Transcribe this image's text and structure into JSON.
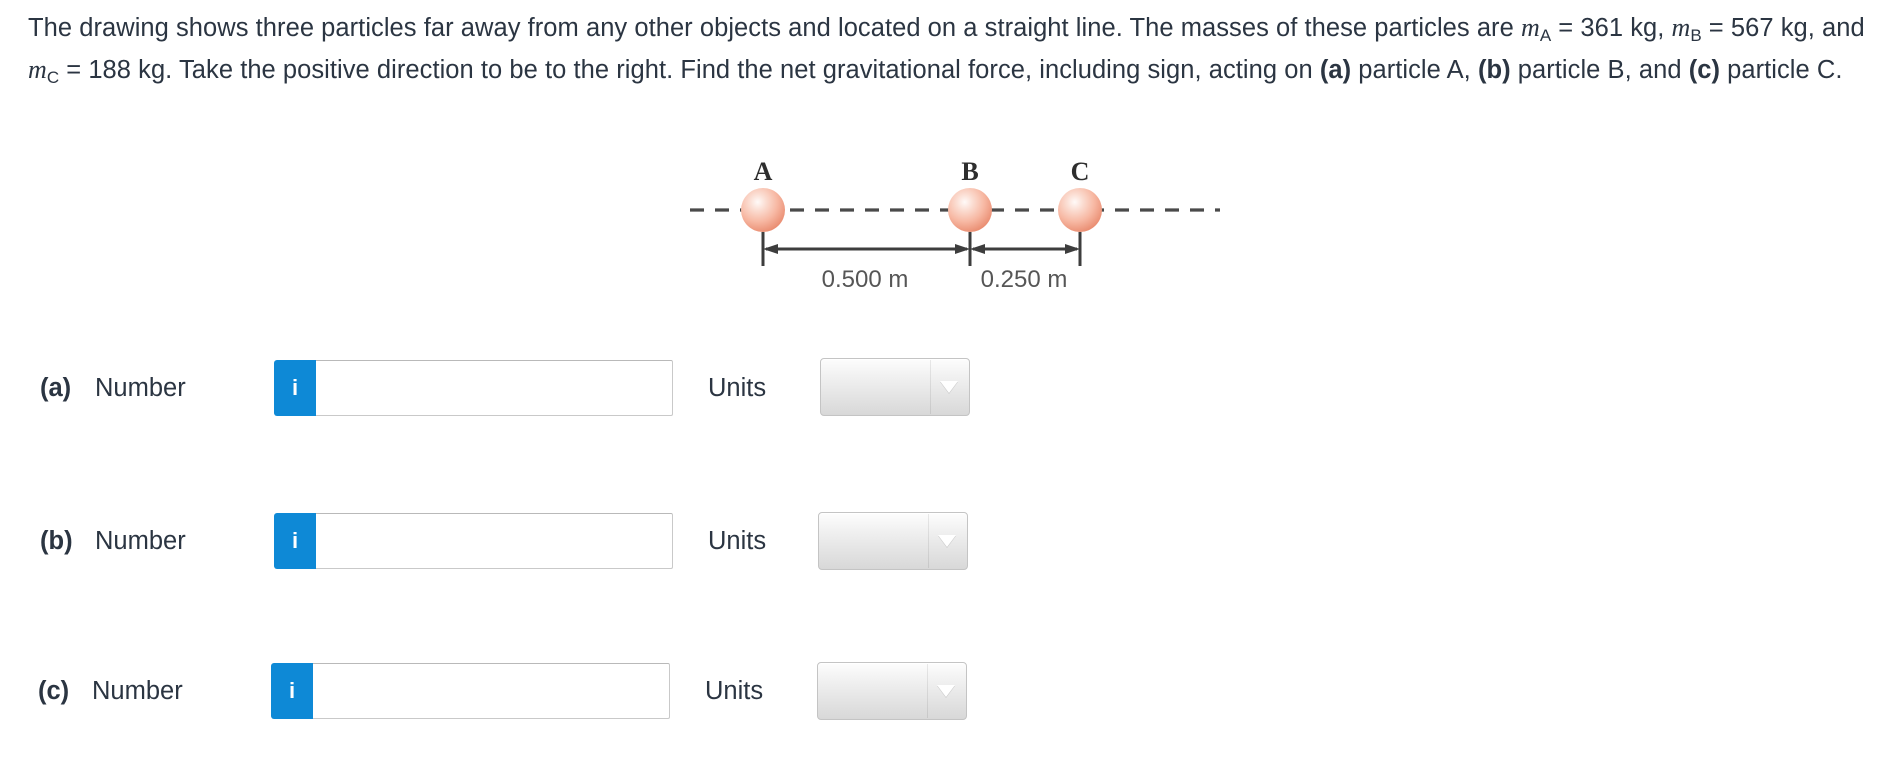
{
  "problem": {
    "text_part_1": "The drawing shows three particles far away from any other objects and located on a straight line. The masses of these particles are ",
    "m_a_symbol": "m",
    "m_a_sub": "A",
    "text_part_2": " =  361 kg, ",
    "m_b_symbol": "m",
    "m_b_sub": "B",
    "text_part_3": " =  567 kg, and ",
    "m_c_symbol": "m",
    "m_c_sub": "C",
    "text_part_4": " =  188 kg. Take the positive direction to be to the right. Find the net gravitational force, including sign, acting on ",
    "bold_a": "(a)",
    "text_part_5": " particle A, ",
    "bold_b": "(b)",
    "text_part_6": " particle B, and ",
    "bold_c": "(c)",
    "text_part_7": " particle C."
  },
  "figure": {
    "particle_a_label": "A",
    "particle_b_label": "B",
    "particle_c_label": "C",
    "distance_ab_label": "0.500 m",
    "distance_bc_label": "0.250 m",
    "particle_color_light": "#fdeae4",
    "particle_color_mid": "#f6b9a6",
    "particle_color_edge": "#ea8b72",
    "line_color": "#4a4a4a",
    "dimension_text_color": "#5a5a5a"
  },
  "answers": [
    {
      "part": "(a)",
      "number_label": "Number",
      "info_icon": "info-icon",
      "number_value": "",
      "number_placeholder": "",
      "units_label": "Units",
      "units_value": "",
      "caret_icon": "chevron-down-icon"
    },
    {
      "part": "(b)",
      "number_label": "Number",
      "info_icon": "info-icon",
      "number_value": "",
      "number_placeholder": "",
      "units_label": "Units",
      "units_value": "",
      "caret_icon": "chevron-down-icon"
    },
    {
      "part": "(c)",
      "number_label": "Number",
      "info_icon": "info-icon",
      "number_value": "",
      "number_placeholder": "",
      "units_label": "Units",
      "units_value": "",
      "caret_icon": "chevron-down-icon"
    }
  ],
  "colors": {
    "accent_blue": "#0e89d6",
    "text": "#2b3542",
    "input_border": "#c9c9c9",
    "select_border": "#c4c4c4"
  }
}
